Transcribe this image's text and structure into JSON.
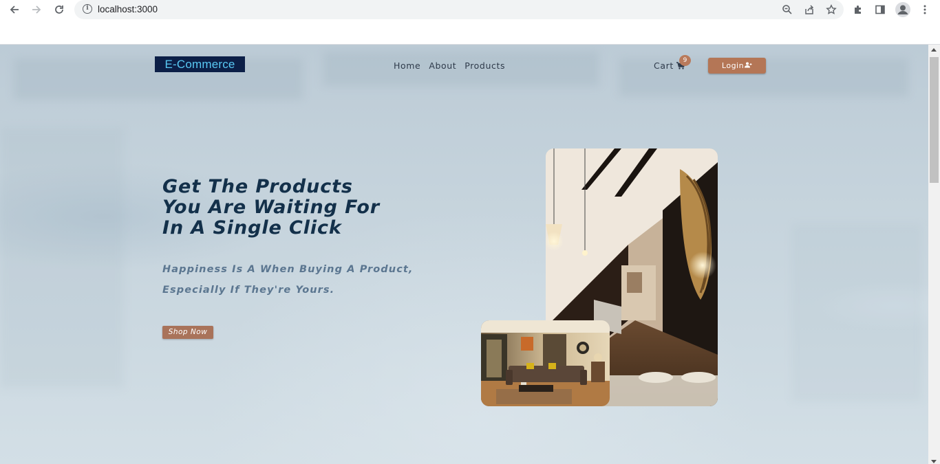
{
  "browser": {
    "url": "localhost:3000",
    "icons": [
      "back-arrow-icon",
      "forward-arrow-icon",
      "reload-icon",
      "site-info-icon",
      "zoom-icon",
      "share-icon",
      "bookmark-star-icon",
      "extensions-icon",
      "side-panel-icon",
      "profile-icon",
      "menu-dots-icon"
    ]
  },
  "navbar": {
    "logo": "E-Commerce",
    "links": [
      "Home",
      "About",
      "Products"
    ],
    "cart_label": "Cart",
    "cart_count": "9",
    "login_label": "Login"
  },
  "hero": {
    "title_lines": [
      "Get The Products",
      "You Are Waiting For",
      "In A Single Click"
    ],
    "subtitle_lines": [
      "Happiness Is A When Buying A Product,",
      "Especially If They're Yours."
    ],
    "cta": "Shop Now"
  },
  "colors": {
    "logo_bg": "#0c1f47",
    "logo_text": "#59c9f4",
    "accent": "#b47656",
    "title": "#13304a",
    "subtitle": "#5b7690"
  }
}
